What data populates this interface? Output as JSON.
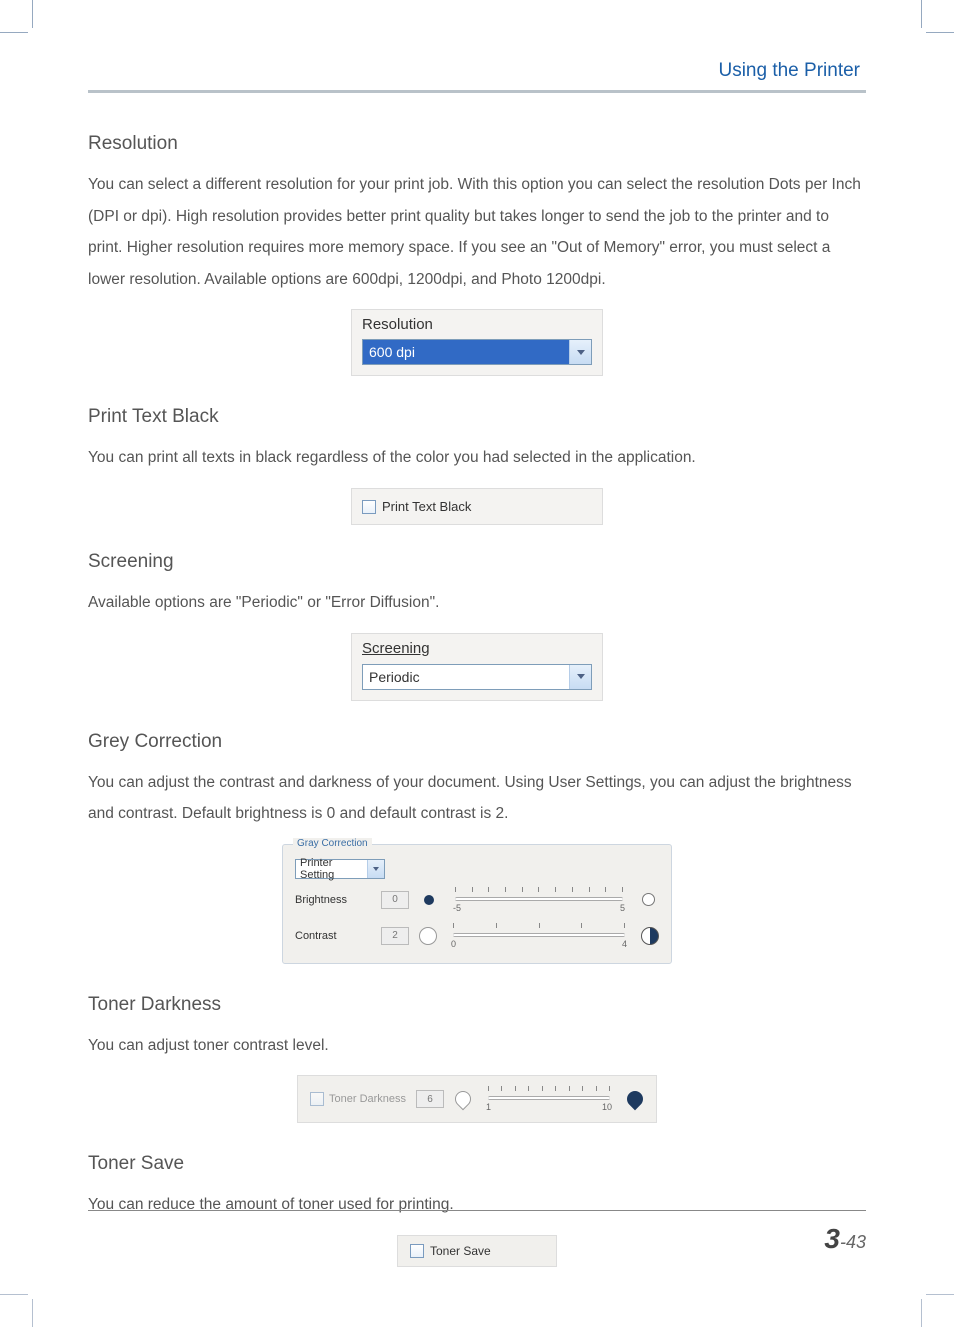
{
  "header": {
    "breadcrumb": "Using the Printer"
  },
  "resolution": {
    "title": "Resolution",
    "body": "You can select a different resolution for your print job. With this option you can select the resolution Dots per Inch (DPI or dpi). High resolution provides better print quality but takes longer to send the job to the printer and to print. Higher resolution requires more memory space. If you see an \"Out of Memory\" error, you must select a lower resolution. Available options are 600dpi, 1200dpi, and Photo 1200dpi.",
    "dd_label": "Resolution",
    "dd_value": "600 dpi"
  },
  "ptb": {
    "title": "Print Text Black",
    "body": "You can print all texts in black regardless of the color you had selected in the application.",
    "chk_label": "Print Text Black"
  },
  "screening": {
    "title": "Screening",
    "body": "Available options are \"Periodic\" or \"Error Diffusion\".",
    "dd_label": "Screening",
    "dd_value": "Periodic"
  },
  "grey": {
    "title": "Grey Correction",
    "body": "You can adjust the contrast and darkness of your document. Using User Settings, you can adjust the brightness and contrast. Default brightness is 0 and default contrast is 2.",
    "legend": "Gray Correction",
    "dd_value": "Printer Setting",
    "brightness_label": "Brightness",
    "brightness_value": "0",
    "brightness_low": "-5",
    "brightness_high": "5",
    "contrast_label": "Contrast",
    "contrast_value": "2",
    "contrast_low": "0",
    "contrast_high": "4"
  },
  "td": {
    "title": "Toner Darkness",
    "body": "You can adjust toner contrast level.",
    "chk_label": "Toner Darkness",
    "value": "6",
    "low": "1",
    "high": "10"
  },
  "ts": {
    "title": "Toner Save",
    "body": "You can reduce the amount of toner used for printing.",
    "chk_label": "Toner Save"
  },
  "footer": {
    "chapter": "3",
    "page": "-43"
  }
}
